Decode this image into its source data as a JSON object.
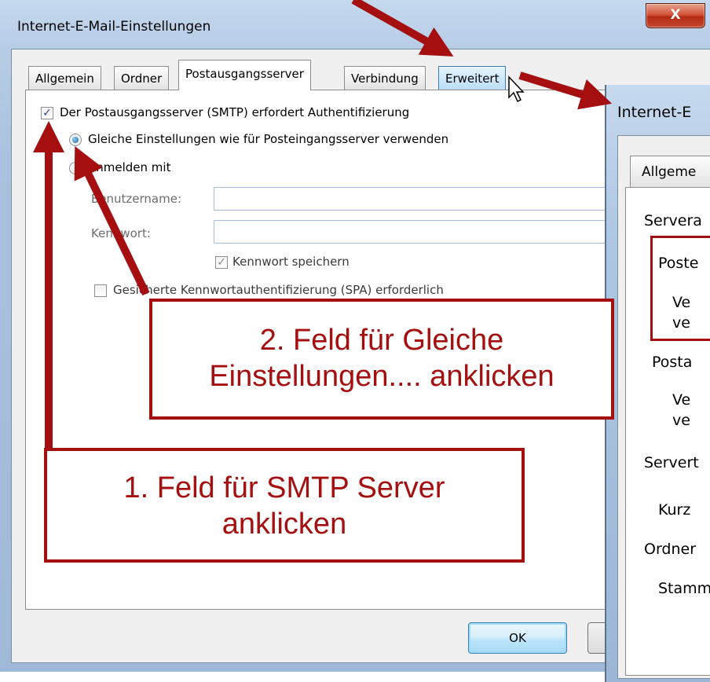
{
  "main_dialog": {
    "title": "Internet-E-Mail-Einstellungen",
    "close_label": "X",
    "tabs": [
      {
        "label": "Allgemein"
      },
      {
        "label": "Ordner"
      },
      {
        "label": "Postausgangsserver"
      },
      {
        "label": "Verbindung"
      },
      {
        "label": "Erweitert"
      }
    ],
    "active_tab": "Postausgangsserver",
    "smtp_auth_checkbox": {
      "label": "Der Postausgangsserver (SMTP) erfordert Authentifizierung",
      "checked": true
    },
    "radio_same_settings": {
      "label": "Gleiche Einstellungen wie für Posteingangsserver verwenden",
      "selected": true
    },
    "radio_login_with": {
      "label": "Anmelden mit",
      "selected": false
    },
    "username_label": "Benutzername:",
    "password_label": "Kennwort:",
    "save_password": {
      "label": "Kennwort speichern",
      "checked": true
    },
    "spa": {
      "label": "Gesicherte Kennwortauthentifizierung (SPA) erforderlich",
      "checked": false
    },
    "ok_label": "OK"
  },
  "second_dialog": {
    "title": "Internet-E",
    "tab_label": "Allgeme",
    "lines": [
      "Servera",
      "Poste",
      "Ve",
      "ve",
      "Posta",
      "Ve",
      "ve",
      "Servert",
      "Kurz",
      "Ordner",
      "Stamm"
    ]
  },
  "annotations": {
    "callout_1": [
      "1. Feld für SMTP Server",
      "anklicken"
    ],
    "callout_2": [
      "2. Feld für Gleiche",
      "Einstellungen.... anklicken"
    ],
    "color": "#a50f0f"
  }
}
